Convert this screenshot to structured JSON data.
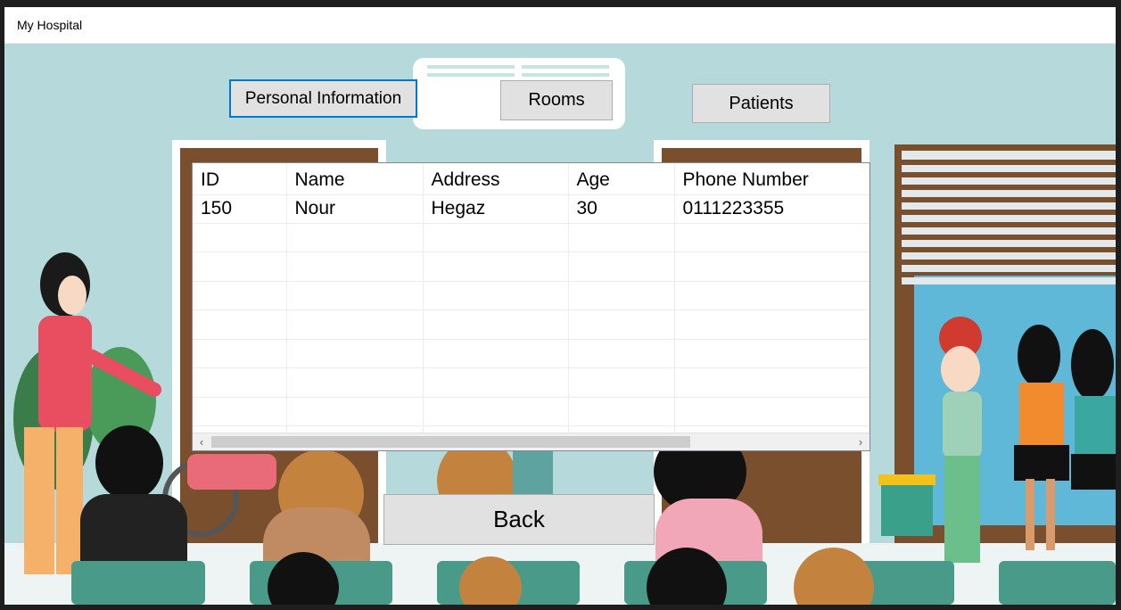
{
  "window": {
    "title": "My Hospital"
  },
  "nav": {
    "personal_label": "Personal Information",
    "rooms_label": "Rooms",
    "patients_label": "Patients"
  },
  "table": {
    "columns": [
      "ID",
      "Name",
      "Address",
      "Age",
      "Phone Number"
    ],
    "rows": [
      [
        "150",
        "Nour",
        "Hegaz",
        "30",
        "0111223355"
      ]
    ]
  },
  "footer": {
    "back_label": "Back"
  },
  "colors": {
    "accent": "#0078d7",
    "background": "#b6dadb",
    "button": "#e1e1e1"
  }
}
